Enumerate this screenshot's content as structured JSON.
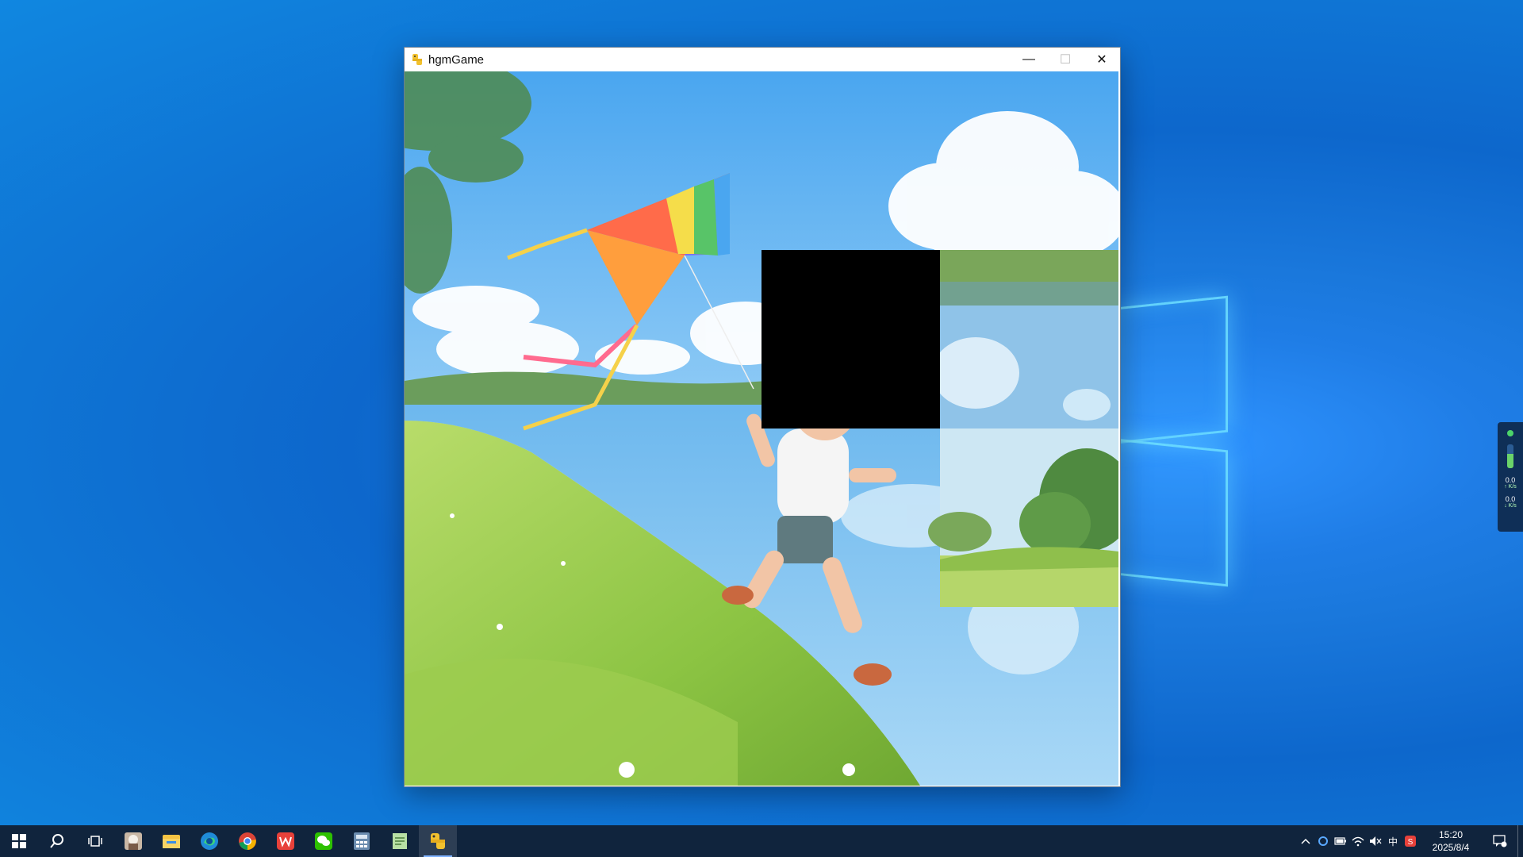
{
  "window": {
    "title": "hgmGame",
    "controls": {
      "minimize": "—",
      "maximize": "☐",
      "close": "✕"
    }
  },
  "game": {
    "grid": "4x4",
    "empty_tile": "black"
  },
  "taskbar": {
    "apps": [
      "start-icon",
      "search-icon",
      "task-view-icon",
      "photo-app-icon",
      "file-explorer-icon",
      "edge-icon",
      "chrome-icon",
      "wps-icon",
      "wechat-icon",
      "calculator-icon",
      "notepad-icon",
      "hgmgame-icon"
    ],
    "active_app": "hgmgame-icon",
    "tray": {
      "ime": "中",
      "time": "15:20",
      "date": "2025/8/4"
    }
  },
  "net_widget": {
    "upload": "0.0",
    "upload_unit": "↑ K/s",
    "download": "0.0",
    "download_unit": "↓ K/s"
  },
  "colors": {
    "desktop": "#1a78dc",
    "taskbar": "#10243d",
    "empty_tile": "#000000"
  }
}
